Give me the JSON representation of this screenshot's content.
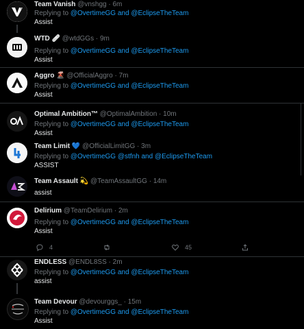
{
  "replying_to_label": "Replying to",
  "and_label": "and",
  "tweets": [
    {
      "name": "Team Vanish",
      "emoji": "",
      "handle": "@vnshgg",
      "dot": "·",
      "time": "6m",
      "mentions": [
        "@OvertimeGG",
        "@EclipseTheTeam"
      ],
      "text": "Assist"
    },
    {
      "name": "WTD",
      "emoji": "🩹",
      "handle": "@wtdGGs",
      "dot": "·",
      "time": "9m",
      "mentions": [
        "@OvertimeGG",
        "@EclipseTheTeam"
      ],
      "text": "Assist"
    },
    {
      "name": "Aggro",
      "emoji": "🌋",
      "handle": "@OfficialAggro",
      "dot": "·",
      "time": "7m",
      "mentions": [
        "@OvertimeGG",
        "@EclipseTheTeam"
      ],
      "text": "Assist"
    },
    {
      "name": "Optimal Ambition™",
      "emoji": "",
      "handle": "@OptimalAmbition",
      "dot": "·",
      "time": "10m",
      "mentions": [
        "@OvertimeGG",
        "@EclipseTheTeam"
      ],
      "text": "Assist"
    },
    {
      "name": "Team Limit",
      "emoji": "💙",
      "handle": "@OfficialLimitGG",
      "dot": "·",
      "time": "3m",
      "mentions": [
        "@OvertimeGG",
        "@stfnh",
        "@EclipseTheTeam"
      ],
      "text": "ASSIST"
    },
    {
      "name": "Team Assault",
      "emoji": "💫",
      "handle": "@TeamAssaultGG",
      "dot": "·",
      "time": "14m",
      "mentions": [],
      "text": "assist"
    },
    {
      "name": "Delirium",
      "emoji": "",
      "handle": "@TeamDelirium",
      "dot": "·",
      "time": "2m",
      "mentions": [
        "@OvertimeGG",
        "@EclipseTheTeam"
      ],
      "text": "Assist"
    },
    {
      "name": "ENDLESS",
      "emoji": "",
      "handle": "@ENDL8SS",
      "dot": "·",
      "time": "2m",
      "mentions": [
        "@OvertimeGG",
        "@EclipseTheTeam"
      ],
      "text": "assist"
    },
    {
      "name": "Team Devour",
      "emoji": "",
      "handle": "@devourggs_",
      "dot": "·",
      "time": "15m",
      "mentions": [
        "@OvertimeGG",
        "@EclipseTheTeam"
      ],
      "text": "Assist"
    }
  ],
  "delirium_actions": {
    "reply_count": "4",
    "retweet_count": "",
    "like_count": "45",
    "icons": [
      "reply-icon",
      "retweet-icon",
      "like-icon",
      "share-icon"
    ]
  },
  "colors": {
    "background": "#000000",
    "mention": "#1d9bf0",
    "muted": "#71767b",
    "text": "#e7e9ea",
    "divider": "#2f3336"
  }
}
